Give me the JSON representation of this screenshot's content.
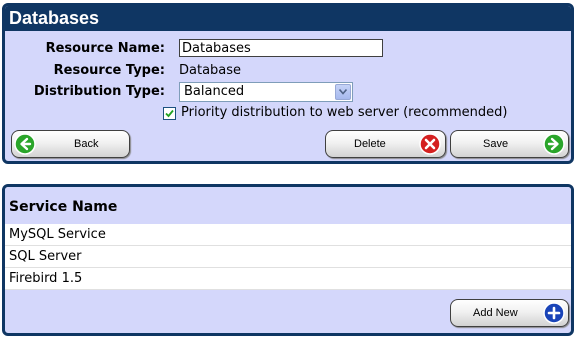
{
  "resource_panel": {
    "title": "Databases",
    "resource_name_label": "Resource Name:",
    "resource_name_value": "Databases",
    "resource_type_label": "Resource Type:",
    "resource_type_value": "Database",
    "distribution_type_label": "Distribution Type:",
    "distribution_type_value": "Balanced",
    "priority_checkbox_label": "Priority distribution to web server (recommended)",
    "priority_checked": true,
    "back_label": "Back",
    "delete_label": "Delete",
    "save_label": "Save"
  },
  "service_panel": {
    "header": "Service Name",
    "rows": [
      "MySQL Service",
      "SQL Server",
      "Firebird 1.5"
    ],
    "add_new_label": "Add New"
  },
  "colors": {
    "panel_border": "#0f3663",
    "panel_bg": "#d4d7fb",
    "back_icon": "#2aa52a",
    "save_icon": "#2aa52a",
    "delete_icon": "#d42020",
    "add_icon": "#1a44b8"
  },
  "icons": {
    "back": "arrow-left-circle-icon",
    "delete": "x-circle-icon",
    "save": "arrow-right-circle-icon",
    "add_new": "plus-circle-icon",
    "dropdown": "chevron-down-icon",
    "checkbox": "checkmark-icon"
  }
}
